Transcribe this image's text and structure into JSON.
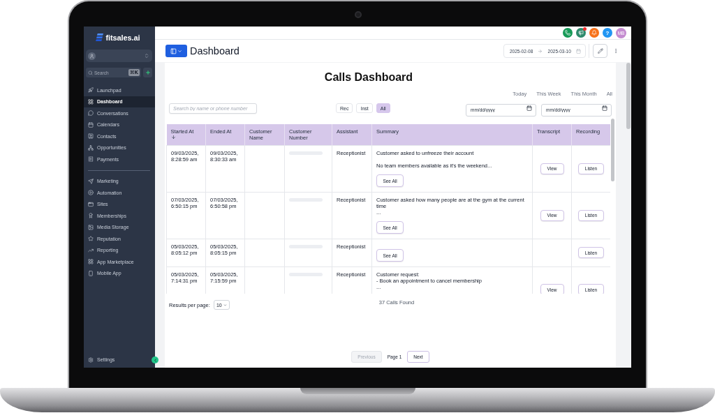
{
  "sidebar": {
    "logo": "fitsales.ai",
    "search": {
      "placeholder": "Search",
      "shortcut": "⌘K"
    },
    "groups": [
      {
        "items": [
          {
            "kind": "launchpad",
            "label": "Launchpad",
            "selected": false
          },
          {
            "kind": "dashboard",
            "label": "Dashboard",
            "selected": true
          },
          {
            "kind": "conversations",
            "label": "Conversations",
            "selected": false
          },
          {
            "kind": "calendars",
            "label": "Calendars",
            "selected": false
          },
          {
            "kind": "contacts",
            "label": "Contacts",
            "selected": false
          },
          {
            "kind": "opportunities",
            "label": "Opportunities",
            "selected": false
          },
          {
            "kind": "payments",
            "label": "Payments",
            "selected": false
          }
        ]
      },
      {
        "items": [
          {
            "kind": "marketing",
            "label": "Marketing",
            "selected": false
          },
          {
            "kind": "automation",
            "label": "Automation",
            "selected": false
          },
          {
            "kind": "sites",
            "label": "Sites",
            "selected": false
          },
          {
            "kind": "memberships",
            "label": "Memberships",
            "selected": false
          },
          {
            "kind": "media",
            "label": "Media Storage",
            "selected": false
          },
          {
            "kind": "reputation",
            "label": "Reputation",
            "selected": false
          },
          {
            "kind": "reporting",
            "label": "Reporting",
            "selected": false
          },
          {
            "kind": "marketplace",
            "label": "App Marketplace",
            "selected": false
          },
          {
            "kind": "mobile",
            "label": "Mobile App",
            "selected": false
          }
        ]
      }
    ],
    "settings": {
      "kind": "settings",
      "label": "Settings",
      "selected": false
    }
  },
  "header": {
    "icons": [
      {
        "kind": "call",
        "dot": false
      },
      {
        "kind": "announcements",
        "dot": true
      },
      {
        "kind": "notifications",
        "dot": false
      },
      {
        "kind": "help",
        "label": "?",
        "dot": false
      }
    ],
    "avatar": "MB"
  },
  "toolbar": {
    "title": "Dashboard",
    "date_from": "2025-02-08",
    "date_to": "2025-03-10"
  },
  "page": {
    "title": "Calls Dashboard",
    "periods": [
      "Today",
      "This Week",
      "This Month",
      "All"
    ],
    "search": {
      "placeholder": "Search by name or phone number"
    },
    "filters": [
      {
        "label": "Rec",
        "selected": false
      },
      {
        "label": "Inst",
        "selected": false
      },
      {
        "label": "All",
        "selected": true
      }
    ],
    "date_fields": [
      {
        "placeholder": "mm/dd/yyyy"
      },
      {
        "placeholder": "mm/dd/yyyy"
      }
    ]
  },
  "table": {
    "columns": [
      {
        "label": "Started At",
        "sorted": true
      },
      {
        "label": "Ended At",
        "sorted": false
      },
      {
        "label": "Customer Name",
        "sorted": false
      },
      {
        "label": "Customer Number",
        "sorted": false
      },
      {
        "label": "Assistant",
        "sorted": false
      },
      {
        "label": "Summary",
        "sorted": false
      },
      {
        "label": "Transcript",
        "sorted": false
      },
      {
        "label": "Recording",
        "sorted": false
      }
    ],
    "rows": [
      {
        "started_at": "09/03/2025, 8:28:59 am",
        "ended_at": "09/03/2025, 8:30:33 am",
        "number_blurred": true,
        "assistant": "Receptionist",
        "summary": [
          "Customer asked to unfreeze their account",
          "No team members available as it's the weekend..."
        ],
        "see_all": "See All",
        "transcript": "View",
        "recording": "Listen"
      },
      {
        "started_at": "07/03/2025, 6:50:15 pm",
        "ended_at": "07/03/2025, 6:50:58 pm",
        "number_blurred": true,
        "assistant": "Receptionist",
        "summary": [
          "Customer asked how many people are at the gym at the current time\n..."
        ],
        "see_all": "See All",
        "transcript": "View",
        "recording": "Listen"
      },
      {
        "started_at": "05/03/2025, 8:05:12 pm",
        "ended_at": "05/03/2025, 8:05:15 pm",
        "number_blurred": true,
        "assistant": "Receptionist",
        "see_all": "See All",
        "recording": "Listen"
      },
      {
        "started_at": "05/03/2025, 7:14:31 pm",
        "ended_at": "05/03/2025, 7:15:59 pm",
        "number_blurred": true,
        "assistant": "Receptionist",
        "summary": [
          "Customer request:\n- Book an appointment to cancel membership\n..."
        ],
        "transcript": "View",
        "recording": "Listen"
      }
    ]
  },
  "footer": {
    "results_label": "Results per page:",
    "per_page": "10",
    "count": "37 Calls Found",
    "pagination": {
      "previous": {
        "label": "Previous",
        "disabled": true
      },
      "page": "Page 1",
      "next": {
        "label": "Next",
        "disabled": false
      }
    }
  }
}
